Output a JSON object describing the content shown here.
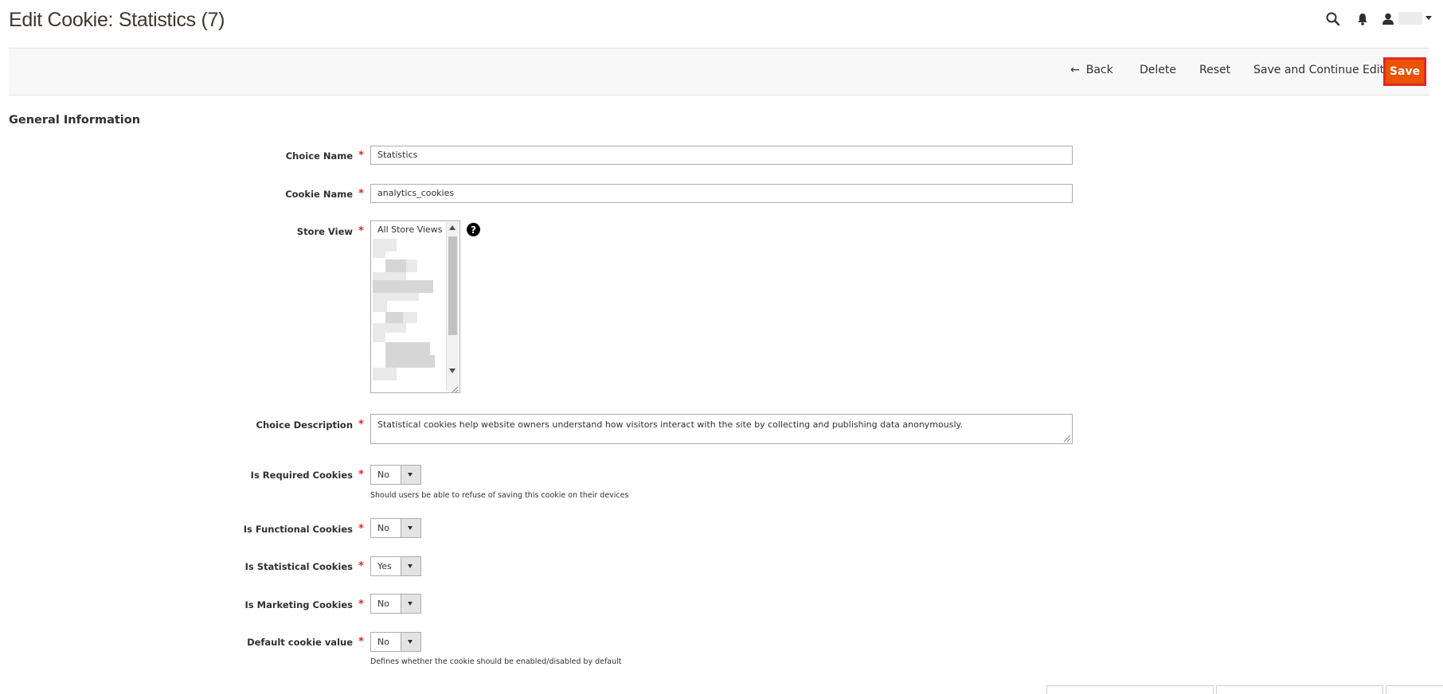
{
  "page": {
    "title": "Edit Cookie: Statistics (7)"
  },
  "header": {
    "icons": [
      "search-icon",
      "bell-icon",
      "user-icon"
    ]
  },
  "actions": {
    "back_label": "Back",
    "delete_label": "Delete",
    "reset_label": "Reset",
    "save_continue_label": "Save and Continue Edit",
    "save_label": "Save"
  },
  "section": {
    "title": "General Information"
  },
  "form": {
    "choice_name": {
      "label": "Choice Name",
      "value": "Statistics"
    },
    "cookie_name": {
      "label": "Cookie Name",
      "value": "analytics_cookies"
    },
    "store_view": {
      "label": "Store View",
      "first_option": "All Store Views",
      "help_glyph": "?"
    },
    "choice_description": {
      "label": "Choice Description",
      "value": "Statistical cookies help website owners understand how visitors interact with the site by collecting and publishing data anonymously."
    },
    "is_required": {
      "label": "Is Required Cookies",
      "value": "No",
      "note": "Should users be able to refuse of saving this cookie on their devices"
    },
    "is_functional": {
      "label": "Is Functional Cookies",
      "value": "No"
    },
    "is_statistical": {
      "label": "Is Statistical Cookies",
      "value": "Yes"
    },
    "is_marketing": {
      "label": "Is Marketing Cookies",
      "value": "No"
    },
    "default_value": {
      "label": "Default cookie value",
      "value": "No",
      "note": "Defines whether the cookie should be enabled/disabled by default"
    },
    "required_mark": "*"
  },
  "colors": {
    "accent": "#eb5202",
    "required": "#e22626"
  }
}
